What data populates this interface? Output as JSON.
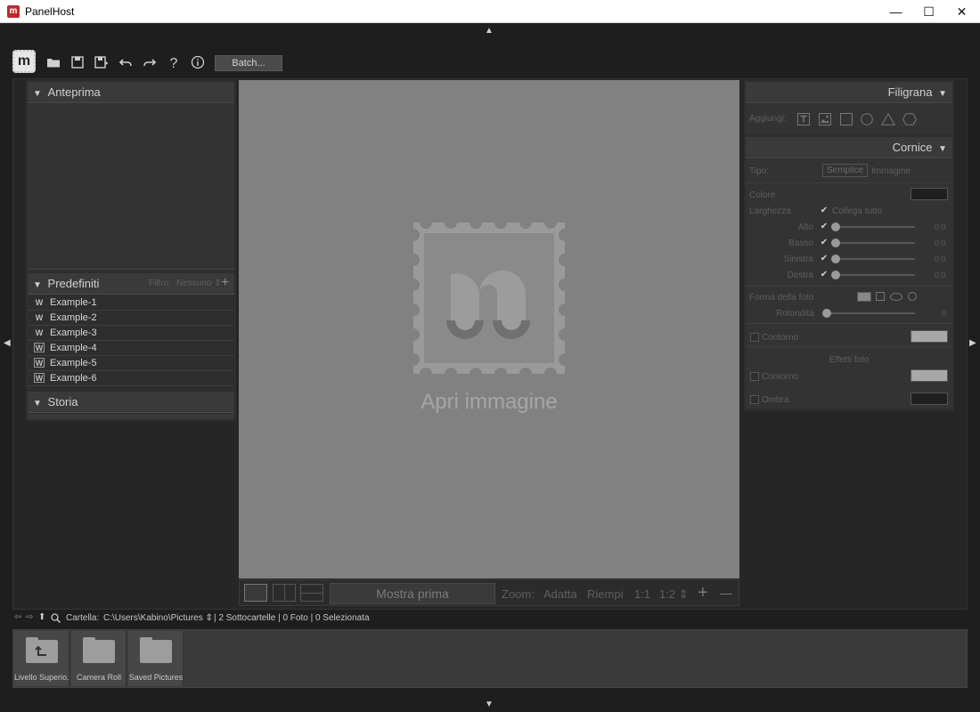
{
  "window": {
    "title": "PanelHost",
    "minimize": "—",
    "maximize": "☐",
    "close": "✕"
  },
  "toolbar": {
    "batch_label": "Batch..."
  },
  "left": {
    "preview_title": "Anteprima",
    "presets_title": "Predefiniti",
    "filter_label": "Filtro:",
    "filter_value": "Nessuno",
    "add_symbol": "+",
    "presets": [
      "Example-1",
      "Example-2",
      "Example-3",
      "Example-4",
      "Example-5",
      "Example-6"
    ],
    "history_title": "Storia"
  },
  "center": {
    "logo_letter": "m",
    "open_label": "Apri immagine",
    "show_before": "Mostra prima",
    "zoom_label": "Zoom:",
    "fit": "Adatta",
    "fill": "Riempi",
    "ratio1": "1:1",
    "ratio2": "1:2",
    "zoom_in": "+",
    "zoom_out": "—"
  },
  "right": {
    "watermark_title": "Filigrana",
    "add_label": "Aggiungi:",
    "frame_title": "Cornice",
    "type_label": "Tipo:",
    "type_simple": "Semplice",
    "type_image": "Immagine",
    "color_label": "Colore",
    "width_label": "Larghezza",
    "link_all": "Collega tutto",
    "sides": [
      {
        "label": "Alto",
        "value": "0.0"
      },
      {
        "label": "Basso",
        "value": "0.0"
      },
      {
        "label": "Sinistra",
        "value": "0.0"
      },
      {
        "label": "Destra",
        "value": "0.0"
      }
    ],
    "shape_label": "Forma della foto",
    "roundness_label": "Rotondità",
    "roundness_value": "0",
    "outline_label": "Contorno",
    "photo_effects": "Effetti foto",
    "photo_outline_label": "Contorno",
    "shadow_label": "Ombra",
    "colors": {
      "frame": "#202020",
      "outline": "#a8a8a8",
      "photo_outline": "#a8a8a8",
      "shadow": "#202020"
    }
  },
  "folderbar": {
    "folder_label": "Cartella:",
    "path": "C:\\Users\\Kabino\\Pictures",
    "stats": "| 2 Sottocartelle | 0 Foto | 0 Selezionata",
    "folders": [
      "Livello Superio...",
      "Camera Roll",
      "Saved Pictures"
    ]
  }
}
